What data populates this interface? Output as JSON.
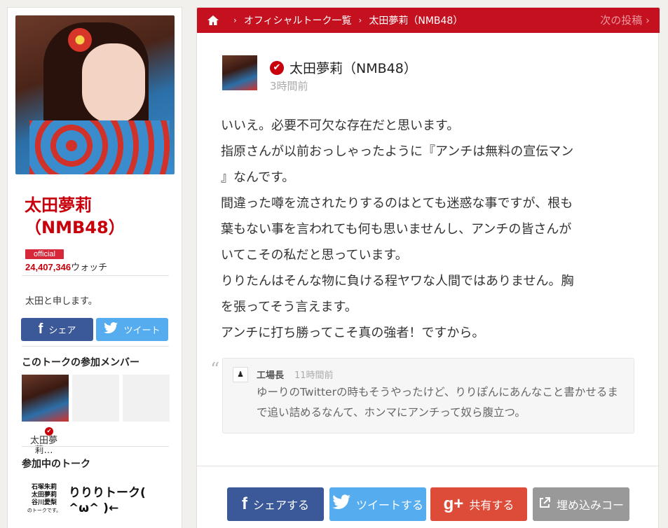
{
  "sidebar": {
    "name_line1": "太田夢莉",
    "name_line2": "（NMB48）",
    "official_badge": "official",
    "watch_count": "24,407,346",
    "watch_suffix": "ウォッチ",
    "description": "太田と申します。",
    "share_facebook": "シェア",
    "share_twitter": "ツイート",
    "members_heading": "このトークの参加メンバー",
    "member_name": "太田夢莉…",
    "talks_heading": "参加中のトーク",
    "talk_thumb_lines": [
      "石塚朱莉",
      "太田夢莉",
      "谷川愛梨",
      "のトークです。"
    ],
    "talk_title": "りりりトーク( ^ω^ )←"
  },
  "topbar": {
    "breadcrumb_list": "オフィシャルトーク一覧",
    "breadcrumb_current": "太田夢莉（NMB48）",
    "next_post": "次の投稿"
  },
  "post": {
    "author": "太田夢莉（NMB48）",
    "time": "3時間前",
    "lines": [
      "いいえ。必要不可欠な存在だと思います。",
      "指原さんが以前おっしゃったように『アンチは無料の宣伝マン",
      "』なんです。",
      "間違った噂を流されたりするのはとても迷惑な事ですが、根も",
      "葉もない事を言われても何も思いませんし、アンチの皆さんが",
      "いてこその私だと思っています。",
      "りりたんはそんな物に負ける程ヤワな人間ではありません。胸",
      "を張ってそう言えます。",
      "アンチに打ち勝ってこそ真の強者！ですから。"
    ]
  },
  "quote": {
    "user": "工場長",
    "time": "11時間前",
    "text": "ゆーりのTwitterの時もそうやったけど、りりぽんにあんなこと書かせるまで追い詰めるなんて、ホンマにアンチって奴ら腹立つ。"
  },
  "share": {
    "facebook": "シェアする",
    "twitter": "ツイートする",
    "googleplus": "共有する",
    "embed": "埋め込みコー"
  },
  "colors": {
    "accent": "#c4101f",
    "facebook": "#3b5998",
    "twitter": "#55acee",
    "googleplus": "#dd4b39"
  }
}
